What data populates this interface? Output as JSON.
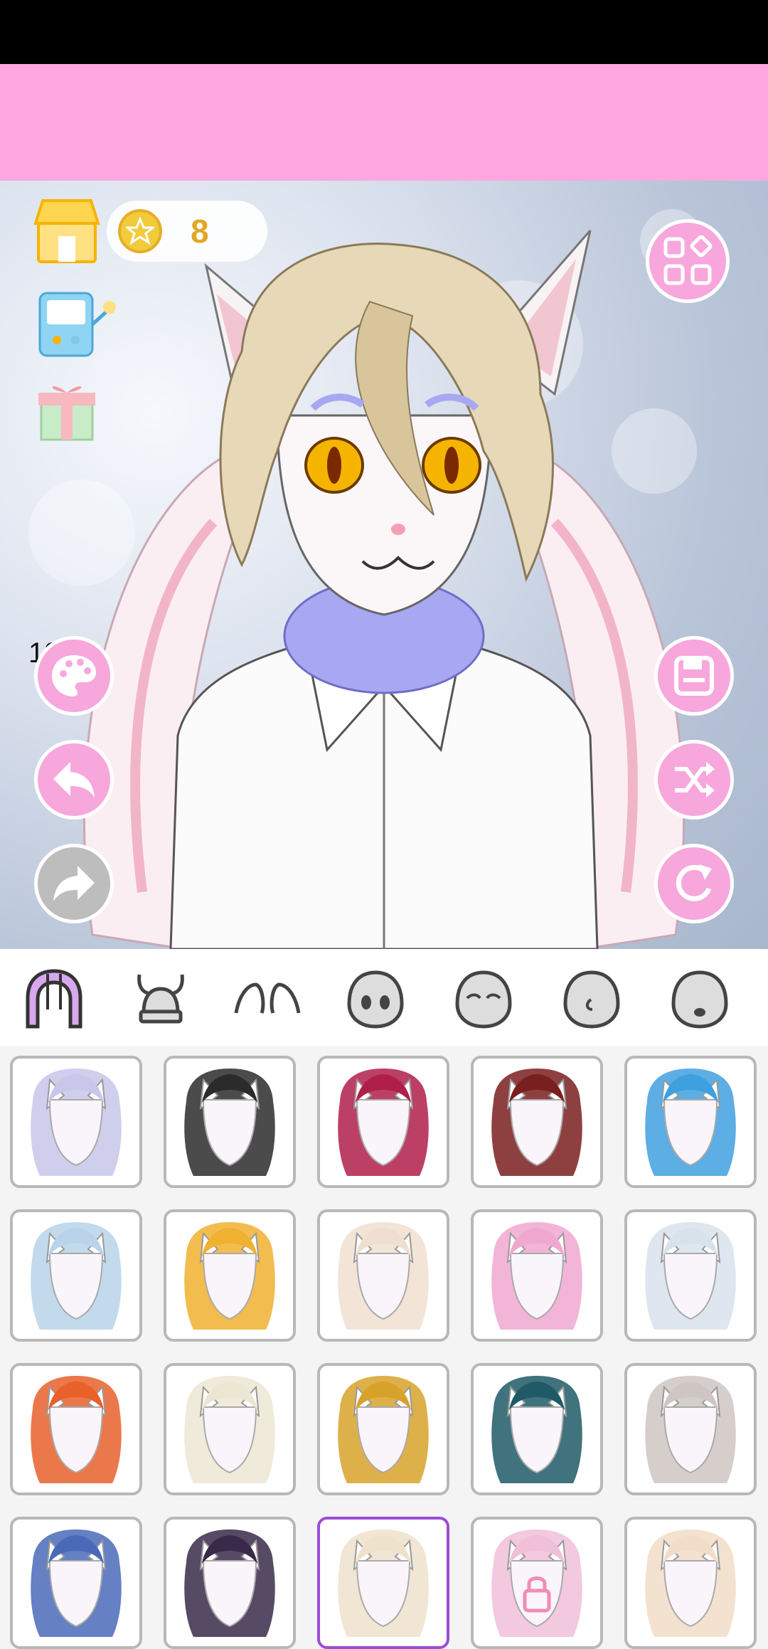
{
  "status_bar": {},
  "header": {
    "coins": "8",
    "timer": "12:50"
  },
  "colors": {
    "accent_pink": "#f7a7dc",
    "banner_pink": "#ffa7e0",
    "selected_border": "#9b4dd8",
    "cell_border": "#b8b8b8"
  },
  "left_icons": [
    "shop-icon",
    "arcade-machine-icon",
    "gift-icon"
  ],
  "tool_buttons_left": [
    "palette-icon",
    "undo-icon",
    "redo-icon"
  ],
  "tool_buttons_right": [
    "save-icon",
    "shuffle-icon",
    "reset-icon"
  ],
  "category_tabs": [
    {
      "name": "hair",
      "selected": true
    },
    {
      "name": "helmet"
    },
    {
      "name": "ears"
    },
    {
      "name": "eyes-face"
    },
    {
      "name": "closed-eyes-face"
    },
    {
      "name": "side-face"
    },
    {
      "name": "mouth-face"
    }
  ],
  "hair_items": [
    {
      "color": "#c8c6ea",
      "style": "fluffy"
    },
    {
      "color": "#2b2b2b",
      "style": "braids"
    },
    {
      "color": "#b01f4a",
      "style": "spiky-top"
    },
    {
      "color": "#7a1f1f",
      "style": "long"
    },
    {
      "color": "#3fa0e0",
      "style": "spiky-side"
    },
    {
      "color": "#b9d4ea",
      "style": "short-spiky"
    },
    {
      "color": "#f0b030",
      "style": "rainbow"
    },
    {
      "color": "#f0dfd0",
      "style": "tufts"
    },
    {
      "color": "#f0a8d0",
      "style": "bob"
    },
    {
      "color": "#d8e2ec",
      "style": "messy"
    },
    {
      "color": "#e8602a",
      "style": "braids-short"
    },
    {
      "color": "#ece6d2",
      "style": "long-flow"
    },
    {
      "color": "#d8a22a",
      "style": "pharaoh"
    },
    {
      "color": "#1f5a66",
      "style": "medusa"
    },
    {
      "color": "#cfc6c2",
      "style": "long-straight"
    },
    {
      "color": "#4a6ab8",
      "style": "bandana"
    },
    {
      "color": "#3a2a4a",
      "style": "dark-spiky"
    },
    {
      "color": "#efe2cc",
      "style": "selected-current",
      "selected": true
    },
    {
      "color": "#f0c0d8",
      "style": "locked",
      "locked": true
    },
    {
      "color": "#f2ddc8",
      "style": "curly"
    }
  ]
}
